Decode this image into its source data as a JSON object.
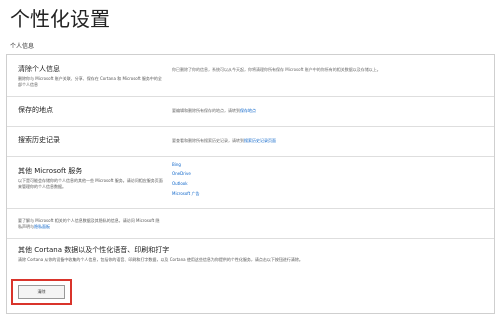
{
  "page": {
    "title": "个性化设置",
    "section_label": "个人信息"
  },
  "rows": [
    {
      "heading": "清除个人信息",
      "sub": "删除你与 Microsoft 账户关联、分享、保存在 Cortana 和 Microsoft 服务中的全部个人信息",
      "desc": "你已删除了你的信息，系统可以从今天起，你将清理你所有保存 Microsoft 账户中的你所有的相关数据以及存储以上。"
    },
    {
      "heading": "保存的地点",
      "desc": "要编辑和删除所有保存的地点，请转到",
      "link": "保存地点"
    },
    {
      "heading": "搜索历史记录",
      "desc": "要查看和删除所有搜索历史记录，请转到",
      "link": "搜索历史记录页面"
    },
    {
      "heading": "其他 Microsoft 服务",
      "sub": "以下是可能会存储你的个人信息的其他一些 Microsoft 服务。请访问相应服务页面来管理你的个人信息数据。",
      "services": [
        "Bing",
        "OneDrive",
        "Outlook",
        "Microsoft 广告"
      ]
    },
    {
      "sub": "要了解与 Microsoft 相关的个人信息数据及其隐私的信息，请访问 Microsoft 隐私声明与",
      "link": "隐私面板"
    },
    {
      "heading": "其他 Cortana 数据以及个性化语音、印刷和打字",
      "sub": "清除 Cortana 从你的设备中收集的个人信息，包括你的语音、印刷和打字数据，以及 Cortana 使用这些信息为你提供的个性化服务，请点击以下按钮进行清除。"
    }
  ],
  "clear_button": {
    "label": "清除"
  },
  "colors": {
    "highlight": "#d9342b",
    "link": "#0a63c9"
  }
}
